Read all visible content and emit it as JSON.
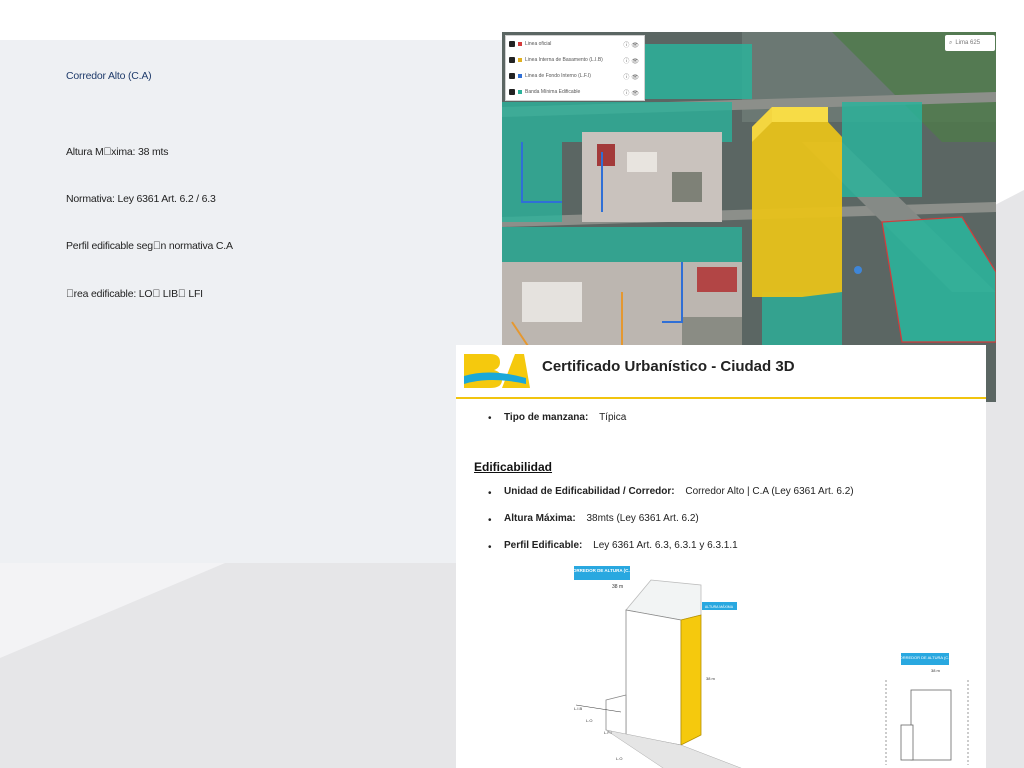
{
  "summary": {
    "corridor": "Corredor Alto (C.A)",
    "max_height": "Altura M\u0000xima: 38 mts",
    "regulation": "Normativa: Ley 6361 Art. 6.2 / 6.3",
    "profile": "Perfil edificable seg\u0000n normativa C.A",
    "area": "\u0000rea edificable: LO\u0000 LIB\u0000 LFI"
  },
  "map": {
    "layers": [
      {
        "label": "Linea oficial",
        "color": "#d33b3b"
      },
      {
        "label": "Linea Interna de Basamento (L.I.B)",
        "color": "#e0b020"
      },
      {
        "label": "Linea de Fondo Interno (L.F.I)",
        "color": "#2f6fd6"
      },
      {
        "label": "Banda Mínima Edificable",
        "color": "#2bb29a"
      }
    ],
    "search_text": "Lima 625"
  },
  "certificate": {
    "logo": "BA",
    "title": "Certificado Urbanístico - Ciudad 3D",
    "block_type_label": "Tipo de manzana:",
    "block_type_value": "Típica",
    "section": "Edificabilidad",
    "unit_label": "Unidad de Edificabilidad / Corredor:",
    "unit_value": "Corredor Alto | C.A (Ley 6361 Art. 6.2)",
    "height_label": "Altura Máxima:",
    "height_value": "38mts (Ley 6361 Art. 6.2)",
    "profile_label": "Perfil Edificable:",
    "profile_value": "Ley 6361 Art. 6.3, 6.3.1 y 6.3.1.1",
    "diagram": {
      "tag_left": "CORREDOR DE ALTURA (C.A)",
      "tag_right": "CORREDOR DE ALTURA (C.A)",
      "height_text": "38 m",
      "height_text_right": "38 m",
      "label_max": "ALTURA MÁXIMA",
      "lines": [
        "L.I.B",
        "L.O",
        "L.F.I",
        "L.O"
      ]
    }
  }
}
